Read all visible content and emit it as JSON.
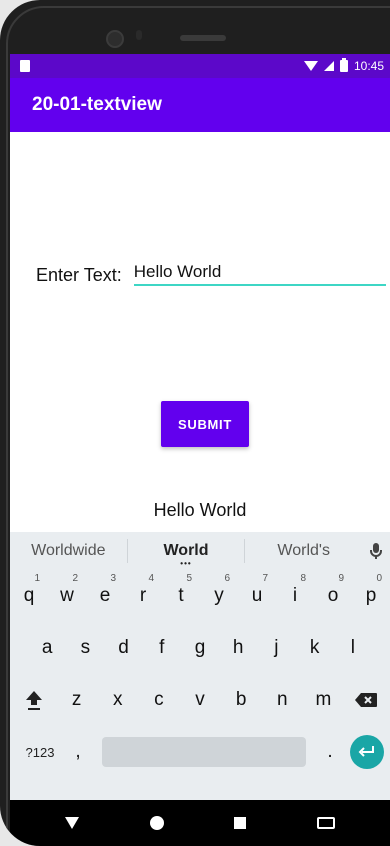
{
  "status_bar": {
    "time": "10:45"
  },
  "app_bar": {
    "title": "20-01-textview"
  },
  "form": {
    "label": "Enter Text:",
    "input_value": "Hello World"
  },
  "actions": {
    "submit_label": "SUBMIT"
  },
  "output": {
    "text": "Hello World"
  },
  "keyboard": {
    "suggestions": [
      "Worldwide",
      "World",
      "World's"
    ],
    "row1": [
      {
        "key": "q",
        "num": "1"
      },
      {
        "key": "w",
        "num": "2"
      },
      {
        "key": "e",
        "num": "3"
      },
      {
        "key": "r",
        "num": "4"
      },
      {
        "key": "t",
        "num": "5"
      },
      {
        "key": "y",
        "num": "6"
      },
      {
        "key": "u",
        "num": "7"
      },
      {
        "key": "i",
        "num": "8"
      },
      {
        "key": "o",
        "num": "9"
      },
      {
        "key": "p",
        "num": "0"
      }
    ],
    "row2": [
      "a",
      "s",
      "d",
      "f",
      "g",
      "h",
      "j",
      "k",
      "l"
    ],
    "row3": [
      "z",
      "x",
      "c",
      "v",
      "b",
      "n",
      "m"
    ],
    "bottom": {
      "symbols_label": "?123",
      "comma": ",",
      "period": "."
    }
  },
  "colors": {
    "primary": "#6200ee",
    "status_bar": "#5c08c9",
    "input_underline": "#3dd6c5",
    "enter_key": "#1aa6a6"
  },
  "icons": [
    "wifi-icon",
    "signal-icon",
    "battery-icon",
    "mic-icon",
    "shift-icon",
    "backspace-icon",
    "enter-icon",
    "nav-back-icon",
    "nav-home-icon",
    "nav-recents-icon",
    "keyboard-switch-icon"
  ]
}
